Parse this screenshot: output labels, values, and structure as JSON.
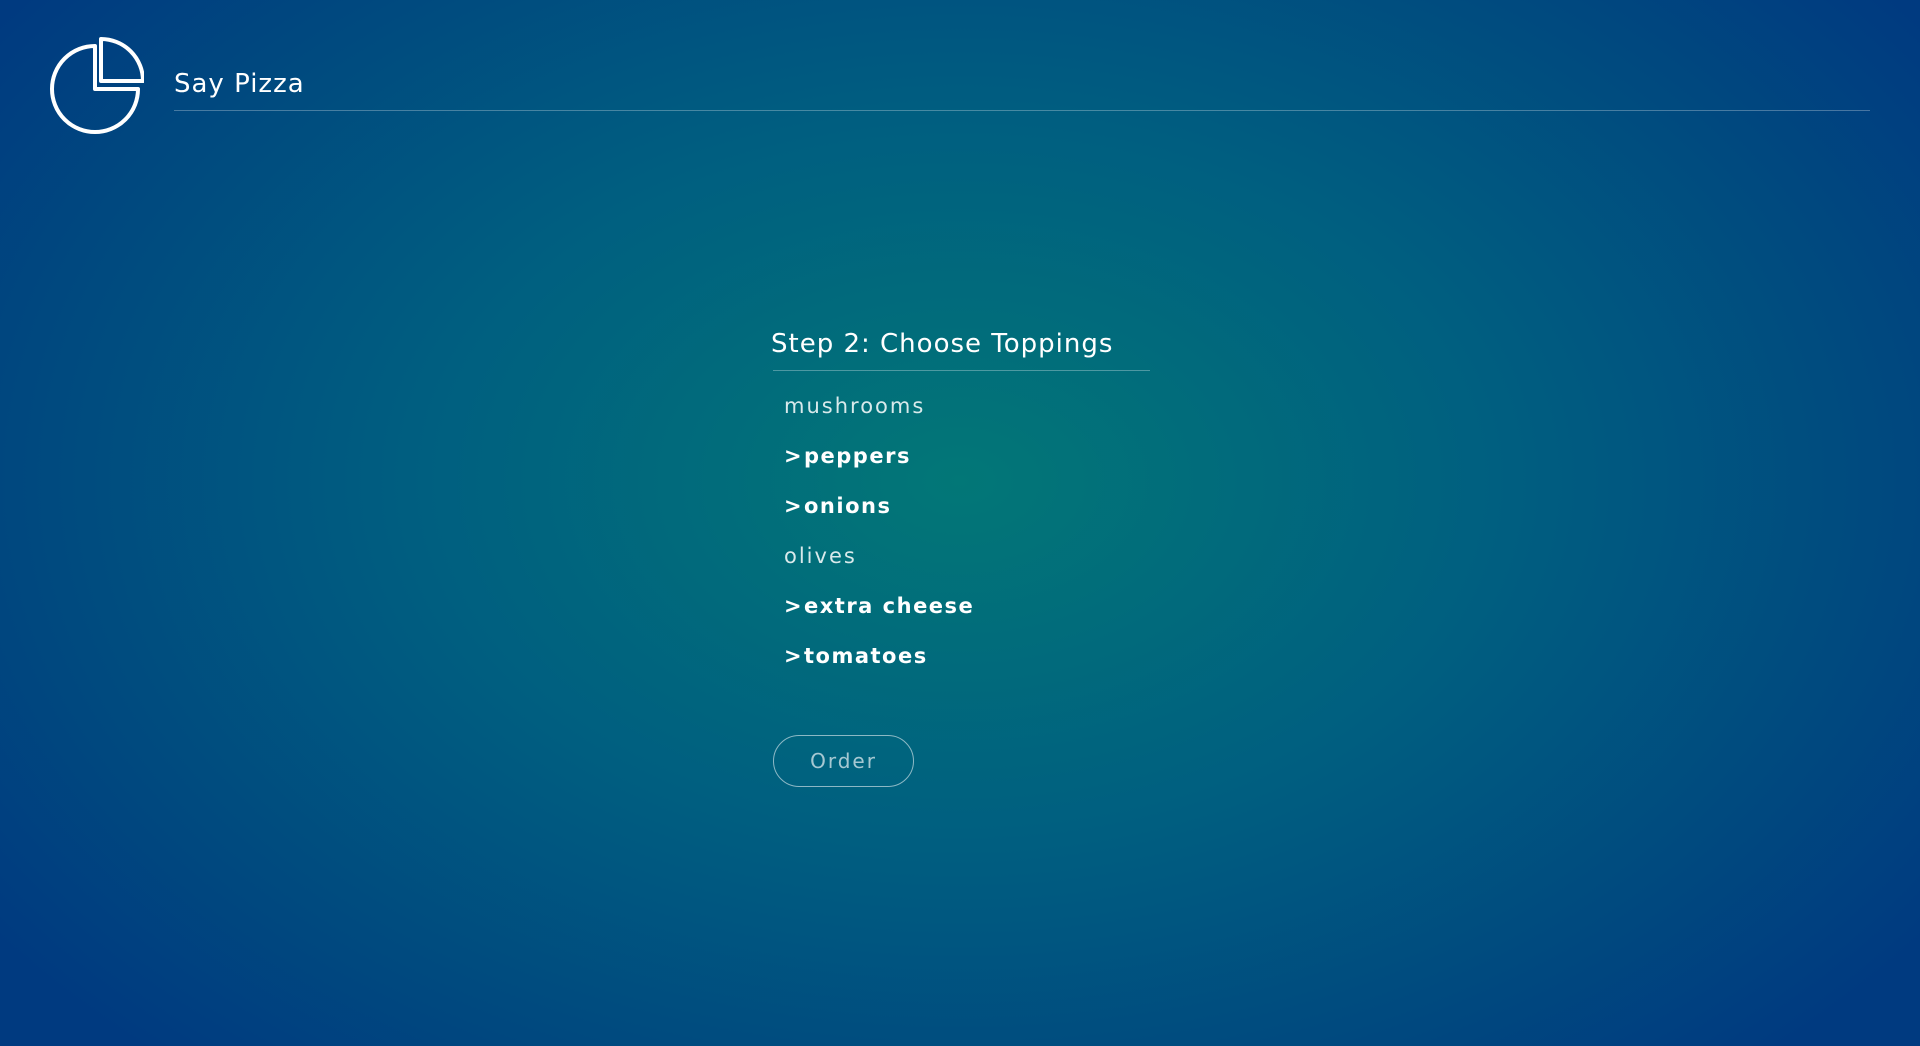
{
  "app": {
    "title": "Say Pizza",
    "logo_icon": "pie-chart-icon"
  },
  "step": {
    "title": "Step 2: Choose Toppings"
  },
  "toppings": [
    {
      "label": "mushrooms",
      "selected": false
    },
    {
      "label": "peppers",
      "selected": true
    },
    {
      "label": "onions",
      "selected": true
    },
    {
      "label": "olives",
      "selected": false
    },
    {
      "label": "extra cheese",
      "selected": true
    },
    {
      "label": "tomatoes",
      "selected": true
    }
  ],
  "selected_marker": ">",
  "order": {
    "label": "Order"
  },
  "colors": {
    "background_center": "#027777",
    "background_edge": "#003a80",
    "text": "#ffffff"
  }
}
